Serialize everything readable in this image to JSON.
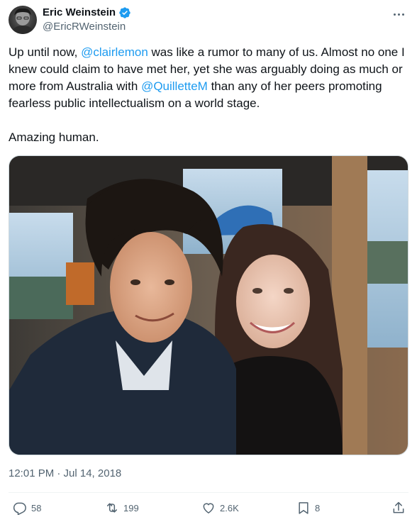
{
  "author": {
    "display_name": "Eric Weinstein",
    "handle": "@EricRWeinstein"
  },
  "tweet": {
    "segments": [
      {
        "text": "Up until now, ",
        "type": "text"
      },
      {
        "text": "@clairlemon",
        "type": "mention"
      },
      {
        "text": " was like a rumor to many of us. Almost no one I knew could claim to have met her, yet she was arguably doing as much or more from Australia with ",
        "type": "text"
      },
      {
        "text": "@QuilletteM",
        "type": "mention"
      },
      {
        "text": " than any of her peers promoting fearless public intellectualism on a world stage.",
        "type": "text"
      }
    ],
    "closing": "Amazing human.",
    "timestamp": "12:01 PM · Jul 14, 2018"
  },
  "actions": {
    "replies": "58",
    "reposts": "199",
    "likes": "2.6K",
    "bookmarks": "8"
  },
  "colors": {
    "link": "#1d9bf0",
    "verified": "#1d9bf0",
    "muted": "#536471"
  }
}
